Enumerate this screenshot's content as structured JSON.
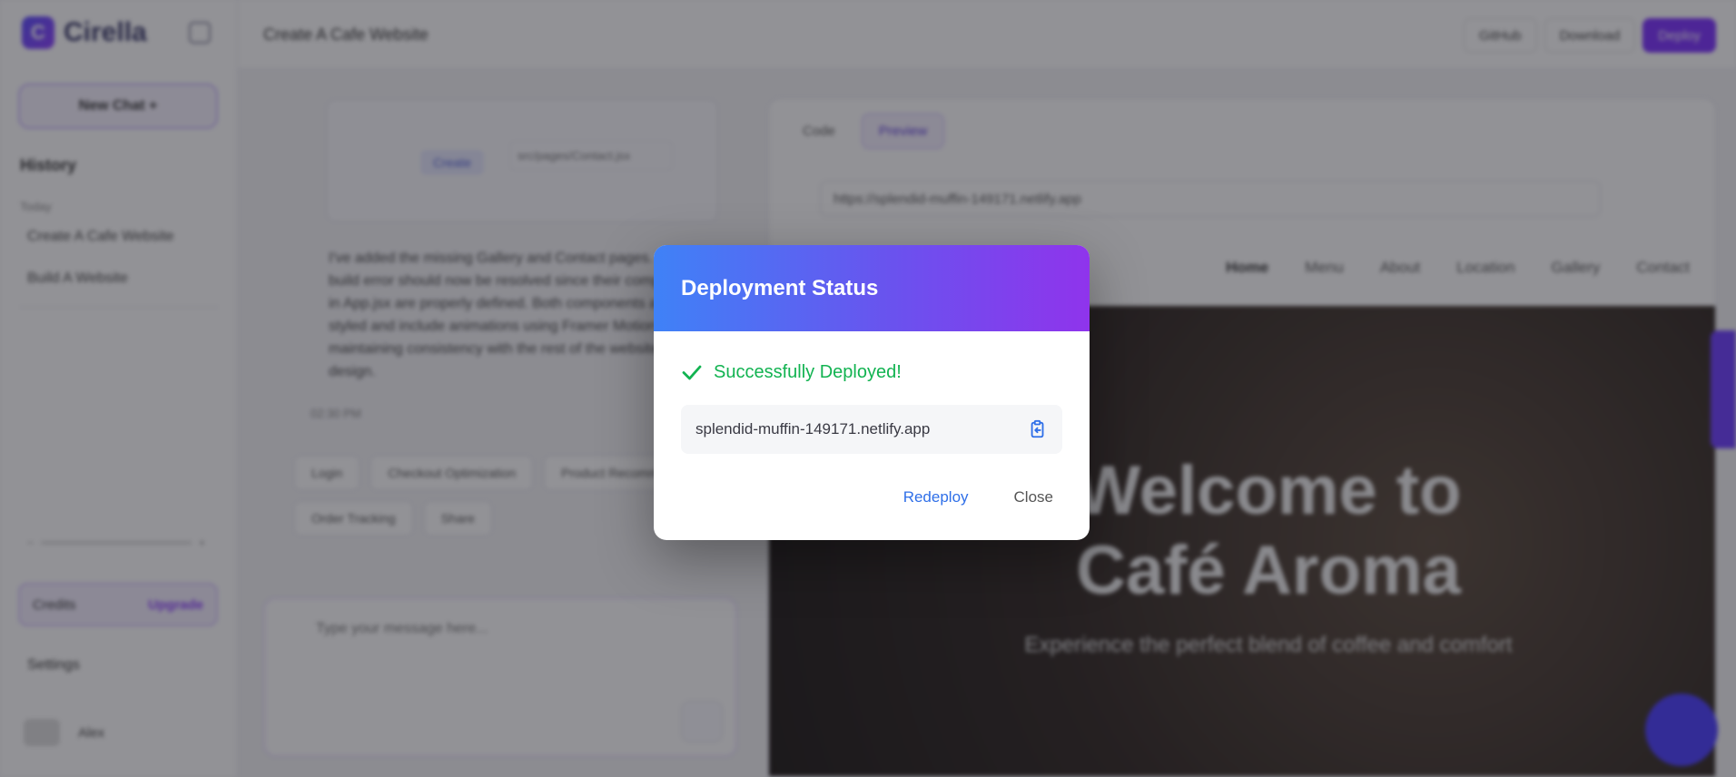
{
  "app": {
    "logo_text": "Cirella",
    "logo_letter": "C",
    "project_title": "Create A Cafe Website",
    "top_actions": [
      "GitHub",
      "Download",
      "Deploy"
    ]
  },
  "sidebar": {
    "new_chat_label": "New Chat +",
    "history_heading": "History",
    "history_group": "Today",
    "history_items": [
      "Create A Cafe Website",
      "Build A Website"
    ],
    "plan_label": "Credits",
    "plan_action": "Upgrade",
    "settings_label": "Settings",
    "user_name": "Alex"
  },
  "chat": {
    "tool_chip": "Create",
    "tool_note": "src/pages/Contact.jsx",
    "assistant_text": "I've added the missing Gallery and Contact pages. The build error should now be resolved since their components in App.jsx are properly defined. Both components are fully styled and include animations using Framer Motion, maintaining consistency with the rest of the website's design.",
    "time": "02:30 PM",
    "suggestions": [
      "Login",
      "Checkout Optimization",
      "Product Recommendations",
      "Order Tracking",
      "Share"
    ],
    "input_placeholder": "Type your message here..."
  },
  "preview": {
    "tabs": [
      "Code",
      "Preview"
    ],
    "url": "https://splendid-muffin-149171.netlify.app",
    "site_nav": [
      "Home",
      "Menu",
      "About",
      "Location",
      "Gallery",
      "Contact"
    ],
    "hero_heading": "Welcome to Café Aroma",
    "hero_sub": "Experience the perfect blend of coffee and comfort"
  },
  "modal": {
    "title": "Deployment Status",
    "status_text": "Successfully Deployed!",
    "deploy_url": "splendid-muffin-149171.netlify.app",
    "redeploy_label": "Redeploy",
    "close_label": "Close",
    "icons": {
      "status": "check-icon",
      "copy": "clipboard-copy-icon"
    },
    "colors": {
      "header_gradient_start": "#3f82f7",
      "header_gradient_end": "#8f34ec",
      "success": "#12b351",
      "link": "#2f6fe8"
    }
  }
}
